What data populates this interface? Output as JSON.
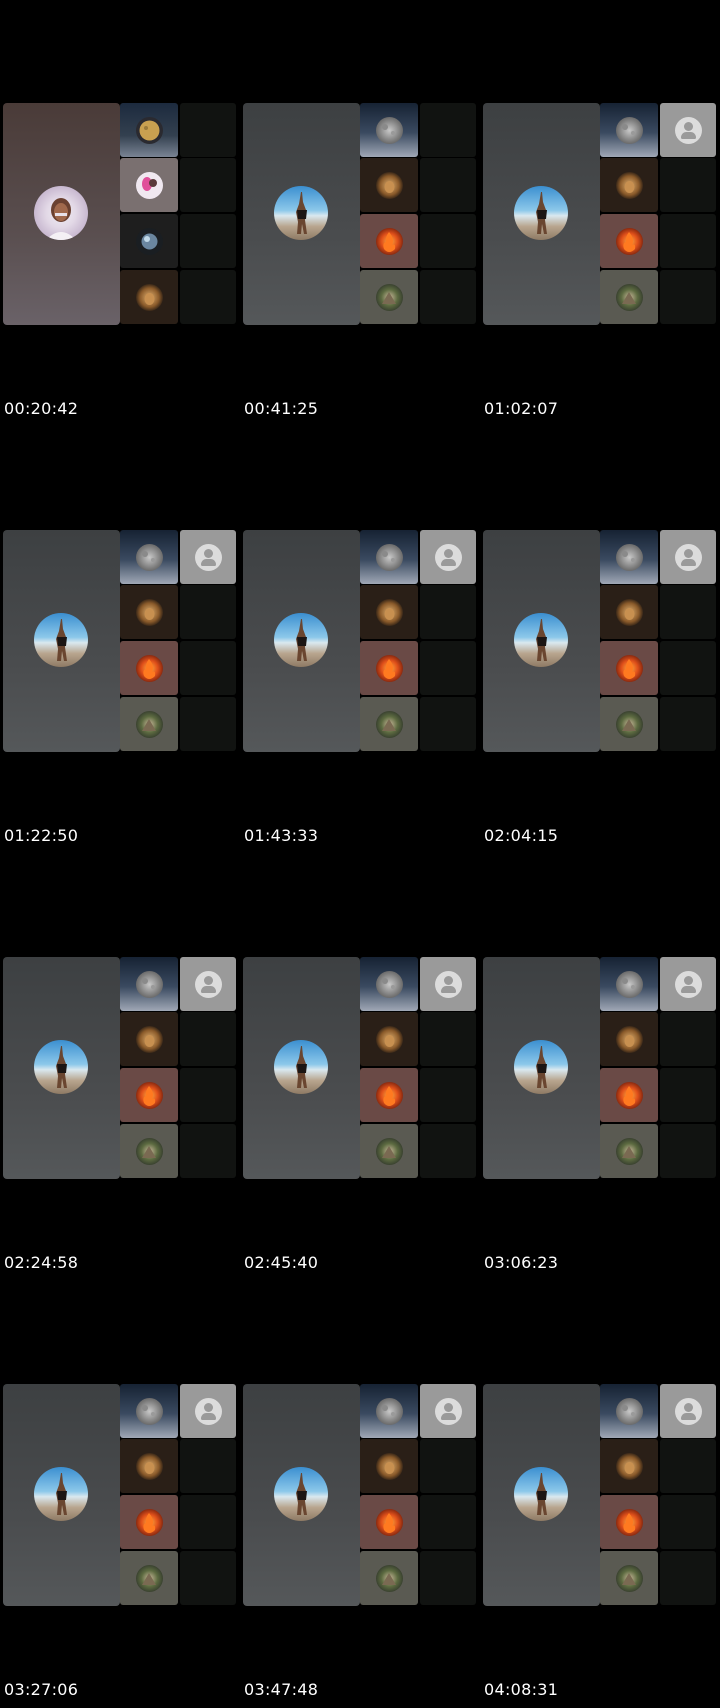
{
  "frames": [
    {
      "timestamp": "00:20:42",
      "variant": "first"
    },
    {
      "timestamp": "00:41:25",
      "variant": "second"
    },
    {
      "timestamp": "01:02:07",
      "variant": "standard"
    },
    {
      "timestamp": "01:22:50",
      "variant": "standard"
    },
    {
      "timestamp": "01:43:33",
      "variant": "standard"
    },
    {
      "timestamp": "02:04:15",
      "variant": "standard"
    },
    {
      "timestamp": "02:24:58",
      "variant": "standard"
    },
    {
      "timestamp": "02:45:40",
      "variant": "standard"
    },
    {
      "timestamp": "03:06:23",
      "variant": "standard"
    },
    {
      "timestamp": "03:27:06",
      "variant": "standard"
    },
    {
      "timestamp": "03:47:48",
      "variant": "standard"
    },
    {
      "timestamp": "04:08:31",
      "variant": "standard"
    }
  ],
  "icons": {
    "main_avatar": "beach-photo-avatar",
    "mini_avatars": [
      "moon-night-avatar",
      "lion-avatar",
      "fire-avatar",
      "nature-avatar"
    ],
    "contact_placeholder": "person-icon"
  },
  "colors": {
    "background": "#000000",
    "tile_gray": "#474a4c",
    "empty_tile": "#111311",
    "contact_tile": "#9a9a9a"
  }
}
